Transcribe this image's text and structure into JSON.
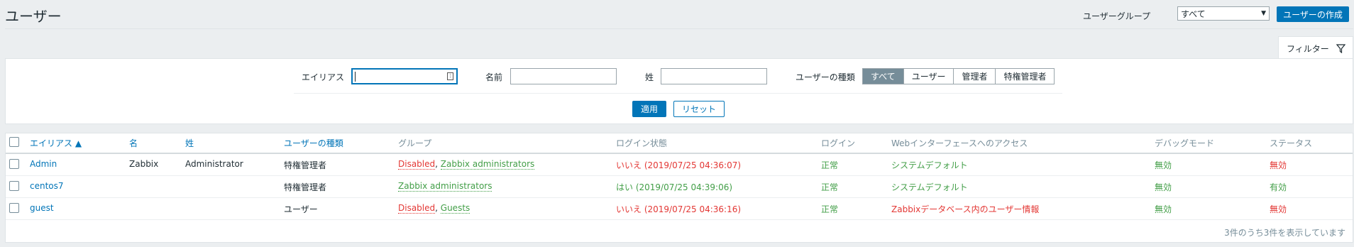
{
  "header": {
    "title": "ユーザー",
    "group_label": "ユーザーグループ",
    "group_select_value": "すべて",
    "create_button": "ユーザーの作成"
  },
  "filter": {
    "tab_label": "フィルター",
    "alias_label": "エイリアス",
    "alias_value": "",
    "name_label": "名前",
    "surname_label": "姓",
    "usertype_label": "ユーザーの種類",
    "usertype_options": [
      "すべて",
      "ユーザー",
      "管理者",
      "特権管理者"
    ],
    "usertype_selected": "すべて",
    "apply_button": "適用",
    "reset_button": "リセット"
  },
  "table": {
    "columns": {
      "alias": "エイリアス ▲",
      "name": "名",
      "surname": "姓",
      "usertype": "ユーザーの種類",
      "groups": "グループ",
      "login_status": "ログイン状態",
      "login": "ログイン",
      "frontend_access": "Webインターフェースへのアクセス",
      "debug_mode": "デバッグモード",
      "status": "ステータス"
    },
    "rows": [
      {
        "alias": "Admin",
        "name": "Zabbix",
        "surname": "Administrator",
        "usertype": "特権管理者",
        "group1": "Disabled",
        "group_sep": ", ",
        "group2": "Zabbix administrators",
        "login_status": "いいえ (2019/07/25 04:36:07)",
        "login": "正常",
        "frontend_access": "システムデフォルト",
        "debug_mode": "無効",
        "status": "無効"
      },
      {
        "alias": "centos7",
        "name": "",
        "surname": "",
        "usertype": "特権管理者",
        "group1": "",
        "group_sep": "",
        "group2": "Zabbix administrators",
        "login_status": "はい (2019/07/25 04:39:06)",
        "login": "正常",
        "frontend_access": "システムデフォルト",
        "debug_mode": "無効",
        "status": "有効"
      },
      {
        "alias": "guest",
        "name": "",
        "surname": "",
        "usertype": "ユーザー",
        "group1": "Disabled",
        "group_sep": ", ",
        "group2": "Guests",
        "login_status": "いいえ (2019/07/25 04:36:16)",
        "login": "正常",
        "frontend_access": "Zabbixデータベース内のユーザー情報",
        "debug_mode": "無効",
        "status": "無効"
      }
    ],
    "footer": "3件のうち3件を表示しています"
  },
  "colors": {
    "accent": "#0275b8",
    "red": "#e33734",
    "green": "#429e47",
    "muted": "#768d99"
  }
}
